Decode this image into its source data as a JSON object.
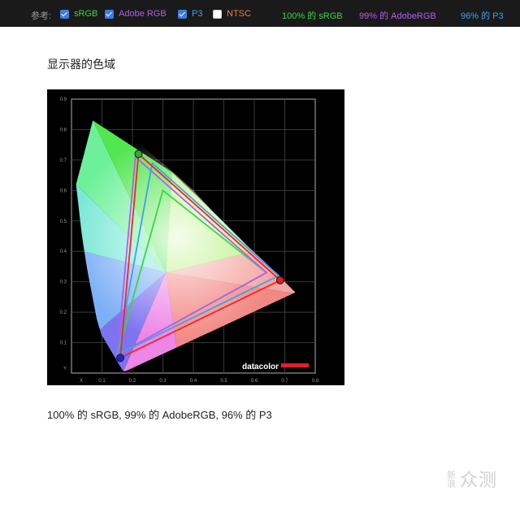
{
  "toolbar": {
    "ref_label": "参考:",
    "options": [
      {
        "label": "sRGB",
        "checked": true,
        "color": "#39d646"
      },
      {
        "label": "Adobe RGB",
        "checked": true,
        "color": "#b05ef0"
      },
      {
        "label": "P3",
        "checked": true,
        "color": "#3fa0f0"
      },
      {
        "label": "NTSC",
        "checked": false,
        "color": "#f07d3c"
      }
    ],
    "stats": [
      {
        "text": "100% 的 sRGB",
        "color": "#39d646"
      },
      {
        "text": "99% 的 AdobeRGB",
        "color": "#b05ef0"
      },
      {
        "text": "96% 的 P3",
        "color": "#3fa0f0"
      }
    ]
  },
  "heading": "显示器的色域",
  "caption": "100% 的 sRGB, 99% 的 AdobeRGB, 96% 的 P3",
  "watermark": {
    "small": "新浪",
    "text": "众测"
  },
  "chart_data": {
    "type": "scatter",
    "title": "",
    "brand": "datacolor",
    "xlabel": "X",
    "ylabel": "Y",
    "xlim": [
      0,
      0.8
    ],
    "ylim": [
      0,
      0.9
    ],
    "xticks": [
      "0.1",
      "0.2",
      "0.3",
      "0.4",
      "0.5",
      "0.6",
      "0.7",
      "0.8"
    ],
    "yticks": [
      "0.1",
      "0.2",
      "0.3",
      "0.4",
      "0.5",
      "0.6",
      "0.7",
      "0.8",
      "0.9"
    ],
    "grid": true,
    "locus": [
      [
        0.175,
        0.005
      ],
      [
        0.165,
        0.01
      ],
      [
        0.15,
        0.02
      ],
      [
        0.135,
        0.04
      ],
      [
        0.12,
        0.07
      ],
      [
        0.1,
        0.12
      ],
      [
        0.082,
        0.18
      ],
      [
        0.068,
        0.25
      ],
      [
        0.055,
        0.32
      ],
      [
        0.042,
        0.4
      ],
      [
        0.03,
        0.48
      ],
      [
        0.018,
        0.56
      ],
      [
        0.012,
        0.62
      ],
      [
        0.012,
        0.68
      ],
      [
        0.02,
        0.74
      ],
      [
        0.035,
        0.79
      ],
      [
        0.055,
        0.825
      ],
      [
        0.075,
        0.835
      ],
      [
        0.1,
        0.83
      ],
      [
        0.13,
        0.815
      ],
      [
        0.17,
        0.79
      ],
      [
        0.22,
        0.755
      ],
      [
        0.28,
        0.705
      ],
      [
        0.34,
        0.655
      ],
      [
        0.4,
        0.6
      ],
      [
        0.46,
        0.535
      ],
      [
        0.52,
        0.475
      ],
      [
        0.58,
        0.415
      ],
      [
        0.64,
        0.36
      ],
      [
        0.7,
        0.3
      ],
      [
        0.735,
        0.265
      ],
      [
        0.175,
        0.005
      ]
    ],
    "series": [
      {
        "name": "sRGB",
        "color": "#39d646",
        "points": [
          [
            0.64,
            0.33
          ],
          [
            0.3,
            0.6
          ],
          [
            0.15,
            0.06
          ]
        ]
      },
      {
        "name": "Adobe RGB",
        "color": "#b05ef0",
        "points": [
          [
            0.64,
            0.33
          ],
          [
            0.21,
            0.71
          ],
          [
            0.15,
            0.06
          ]
        ]
      },
      {
        "name": "P3",
        "color": "#3fa0f0",
        "points": [
          [
            0.68,
            0.32
          ],
          [
            0.265,
            0.69
          ],
          [
            0.15,
            0.06
          ]
        ]
      },
      {
        "name": "display",
        "color": "#ff2020",
        "points": [
          [
            0.685,
            0.305
          ],
          [
            0.22,
            0.72
          ],
          [
            0.16,
            0.05
          ]
        ]
      }
    ],
    "primaries": [
      {
        "name": "red",
        "point": [
          0.685,
          0.305
        ],
        "color": "#e02020"
      },
      {
        "name": "green",
        "point": [
          0.22,
          0.72
        ],
        "color": "#3aa83a"
      },
      {
        "name": "blue",
        "point": [
          0.16,
          0.05
        ],
        "color": "#2020e0"
      }
    ]
  }
}
